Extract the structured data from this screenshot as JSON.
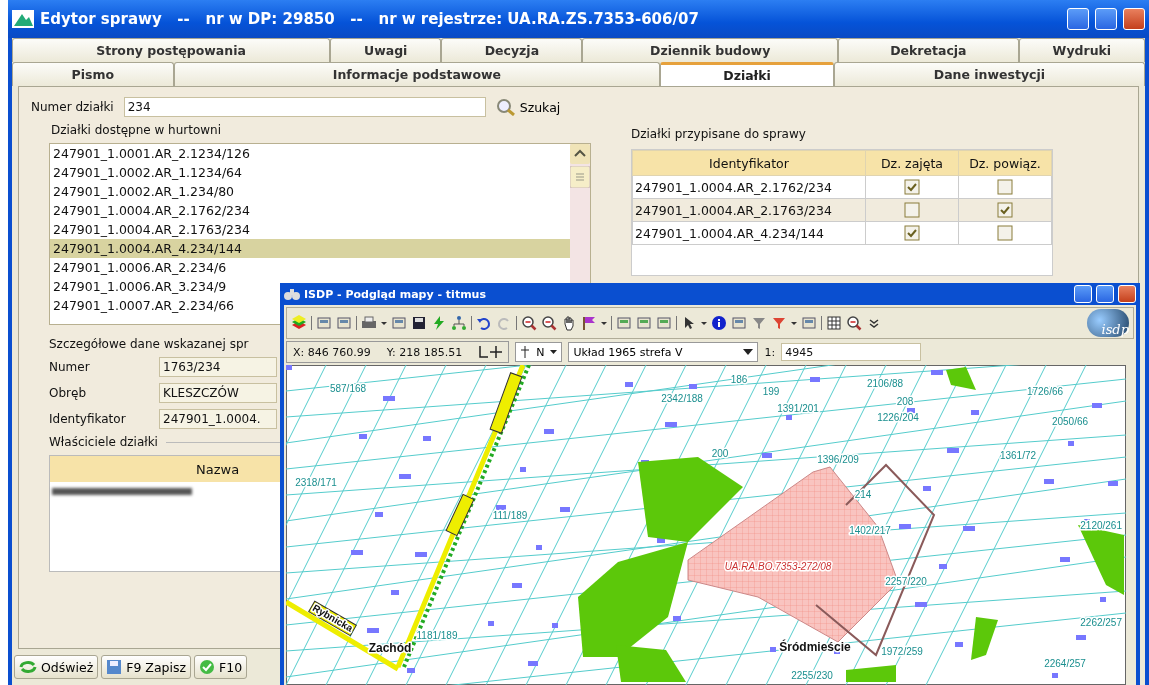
{
  "window": {
    "title": "Edytor sprawy   --   nr w DP: 29850   --   nr w rejestrze: UA.RA.ZS.7353-606/07"
  },
  "tab_rows": [
    [
      {
        "label": "Strony postępowania",
        "selected": false
      },
      {
        "label": "Uwagi",
        "selected": false
      },
      {
        "label": "Decyzja",
        "selected": false
      },
      {
        "label": "Dziennik budowy",
        "selected": false
      },
      {
        "label": "Dekretacja",
        "selected": false
      },
      {
        "label": "Wydruki",
        "selected": false
      }
    ],
    [
      {
        "label": "Pismo",
        "selected": false
      },
      {
        "label": "Informacje podstawowe",
        "selected": false
      },
      {
        "label": "Działki",
        "selected": true
      },
      {
        "label": "Dane inwestycji",
        "selected": false
      }
    ]
  ],
  "search": {
    "label": "Numer działki",
    "value": "234",
    "button": "Szukaj"
  },
  "available": {
    "title": "Działki dostępne w hurtowni",
    "items": [
      {
        "text": "247901_1.0001.AR_2.1234/126",
        "selected": false
      },
      {
        "text": "247901_1.0002.AR_1.1234/64",
        "selected": false
      },
      {
        "text": "247901_1.0002.AR_1.234/80",
        "selected": false
      },
      {
        "text": "247901_1.0004.AR_2.1762/234",
        "selected": false
      },
      {
        "text": "247901_1.0004.AR_2.1763/234",
        "selected": false
      },
      {
        "text": "247901_1.0004.AR_4.234/144",
        "selected": true
      },
      {
        "text": "247901_1.0006.AR_2.234/6",
        "selected": false
      },
      {
        "text": "247901_1.0006.AR_3.234/9",
        "selected": false
      },
      {
        "text": "247901_1.0007.AR_2.234/66",
        "selected": false
      }
    ]
  },
  "details": {
    "title": "Szczegółowe dane wskazanej spr",
    "fields": [
      {
        "label": "Numer",
        "value": "1763/234"
      },
      {
        "label": "Obręb",
        "value": "KLESZCZÓW"
      },
      {
        "label": "Identyfikator",
        "value": "247901_1.0004."
      }
    ],
    "owners_title": "Właściciele działki",
    "owners_column": "Nazwa"
  },
  "assigned": {
    "title": "Działki przypisane do sprawy",
    "columns": [
      "Identyfikator",
      "Dz. zajęta",
      "Dz. powiąz."
    ],
    "rows": [
      {
        "id": "247901_1.0004.AR_2.1762/234",
        "occupied": true,
        "linked": false
      },
      {
        "id": "247901_1.0004.AR_2.1763/234",
        "occupied": false,
        "linked": true
      },
      {
        "id": "247901_1.0004.AR_4.234/144",
        "occupied": true,
        "linked": false
      }
    ]
  },
  "bottom_buttons": [
    "Odśwież",
    "F9 Zapisz",
    "F10"
  ],
  "map_window": {
    "title": "ISDP - Podgląd mapy - titmus",
    "logo": "isdp",
    "x": "X: 846 760.99",
    "y": "Y: 218 185.51",
    "north": "N",
    "crs": "Układ 1965 strefa V",
    "scale_label": "1:",
    "scale": "4945",
    "labels": [
      {
        "text": "587/168",
        "kind": "parcel"
      },
      {
        "text": "186",
        "kind": "parcel"
      },
      {
        "text": "199",
        "kind": "parcel"
      },
      {
        "text": "2106/88",
        "kind": "parcel"
      },
      {
        "text": "2342/188",
        "kind": "parcel"
      },
      {
        "text": "1391/201",
        "kind": "parcel"
      },
      {
        "text": "208",
        "kind": "parcel"
      },
      {
        "text": "1226/204",
        "kind": "parcel"
      },
      {
        "text": "1726/66",
        "kind": "parcel"
      },
      {
        "text": "2050/66",
        "kind": "parcel"
      },
      {
        "text": "200",
        "kind": "parcel"
      },
      {
        "text": "1396/209",
        "kind": "parcel"
      },
      {
        "text": "1361/72",
        "kind": "parcel"
      },
      {
        "text": "2318/171",
        "kind": "parcel"
      },
      {
        "text": "214",
        "kind": "parcel"
      },
      {
        "text": "111/189",
        "kind": "parcel"
      },
      {
        "text": "1402/217",
        "kind": "parcel"
      },
      {
        "text": "2120/261",
        "kind": "parcel"
      },
      {
        "text": "UA.RA.BO.7353-272/08",
        "kind": "case"
      },
      {
        "text": "2257/220",
        "kind": "parcel"
      },
      {
        "text": "1181/189",
        "kind": "parcel"
      },
      {
        "text": "2262/257",
        "kind": "parcel"
      },
      {
        "text": "Zachód",
        "kind": "place"
      },
      {
        "text": "Śródmieście",
        "kind": "place"
      },
      {
        "text": "1972/259",
        "kind": "parcel"
      },
      {
        "text": "2264/257",
        "kind": "parcel"
      },
      {
        "text": "2255/230",
        "kind": "parcel"
      },
      {
        "text": "Rybnicka",
        "kind": "street"
      }
    ]
  }
}
